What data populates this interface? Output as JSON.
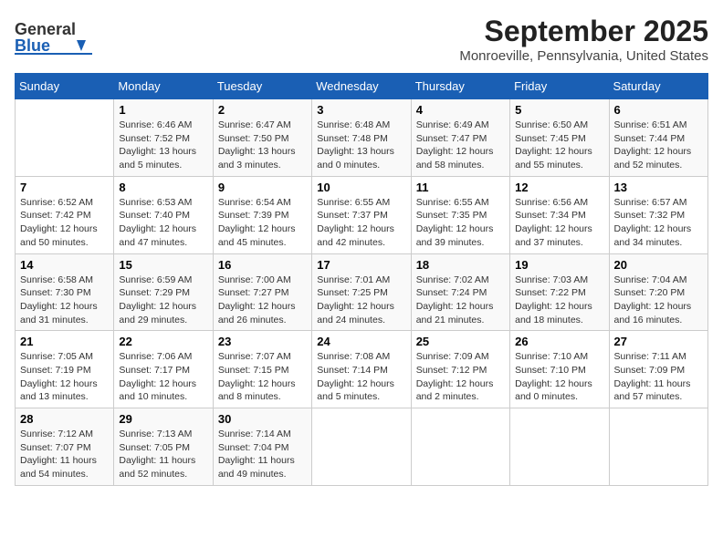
{
  "header": {
    "logo_general": "General",
    "logo_blue": "Blue",
    "title": "September 2025",
    "subtitle": "Monroeville, Pennsylvania, United States"
  },
  "calendar": {
    "days_of_week": [
      "Sunday",
      "Monday",
      "Tuesday",
      "Wednesday",
      "Thursday",
      "Friday",
      "Saturday"
    ],
    "weeks": [
      [
        {
          "date": "",
          "info": ""
        },
        {
          "date": "1",
          "info": "Sunrise: 6:46 AM\nSunset: 7:52 PM\nDaylight: 13 hours\nand 5 minutes."
        },
        {
          "date": "2",
          "info": "Sunrise: 6:47 AM\nSunset: 7:50 PM\nDaylight: 13 hours\nand 3 minutes."
        },
        {
          "date": "3",
          "info": "Sunrise: 6:48 AM\nSunset: 7:48 PM\nDaylight: 13 hours\nand 0 minutes."
        },
        {
          "date": "4",
          "info": "Sunrise: 6:49 AM\nSunset: 7:47 PM\nDaylight: 12 hours\nand 58 minutes."
        },
        {
          "date": "5",
          "info": "Sunrise: 6:50 AM\nSunset: 7:45 PM\nDaylight: 12 hours\nand 55 minutes."
        },
        {
          "date": "6",
          "info": "Sunrise: 6:51 AM\nSunset: 7:44 PM\nDaylight: 12 hours\nand 52 minutes."
        }
      ],
      [
        {
          "date": "7",
          "info": "Sunrise: 6:52 AM\nSunset: 7:42 PM\nDaylight: 12 hours\nand 50 minutes."
        },
        {
          "date": "8",
          "info": "Sunrise: 6:53 AM\nSunset: 7:40 PM\nDaylight: 12 hours\nand 47 minutes."
        },
        {
          "date": "9",
          "info": "Sunrise: 6:54 AM\nSunset: 7:39 PM\nDaylight: 12 hours\nand 45 minutes."
        },
        {
          "date": "10",
          "info": "Sunrise: 6:55 AM\nSunset: 7:37 PM\nDaylight: 12 hours\nand 42 minutes."
        },
        {
          "date": "11",
          "info": "Sunrise: 6:55 AM\nSunset: 7:35 PM\nDaylight: 12 hours\nand 39 minutes."
        },
        {
          "date": "12",
          "info": "Sunrise: 6:56 AM\nSunset: 7:34 PM\nDaylight: 12 hours\nand 37 minutes."
        },
        {
          "date": "13",
          "info": "Sunrise: 6:57 AM\nSunset: 7:32 PM\nDaylight: 12 hours\nand 34 minutes."
        }
      ],
      [
        {
          "date": "14",
          "info": "Sunrise: 6:58 AM\nSunset: 7:30 PM\nDaylight: 12 hours\nand 31 minutes."
        },
        {
          "date": "15",
          "info": "Sunrise: 6:59 AM\nSunset: 7:29 PM\nDaylight: 12 hours\nand 29 minutes."
        },
        {
          "date": "16",
          "info": "Sunrise: 7:00 AM\nSunset: 7:27 PM\nDaylight: 12 hours\nand 26 minutes."
        },
        {
          "date": "17",
          "info": "Sunrise: 7:01 AM\nSunset: 7:25 PM\nDaylight: 12 hours\nand 24 minutes."
        },
        {
          "date": "18",
          "info": "Sunrise: 7:02 AM\nSunset: 7:24 PM\nDaylight: 12 hours\nand 21 minutes."
        },
        {
          "date": "19",
          "info": "Sunrise: 7:03 AM\nSunset: 7:22 PM\nDaylight: 12 hours\nand 18 minutes."
        },
        {
          "date": "20",
          "info": "Sunrise: 7:04 AM\nSunset: 7:20 PM\nDaylight: 12 hours\nand 16 minutes."
        }
      ],
      [
        {
          "date": "21",
          "info": "Sunrise: 7:05 AM\nSunset: 7:19 PM\nDaylight: 12 hours\nand 13 minutes."
        },
        {
          "date": "22",
          "info": "Sunrise: 7:06 AM\nSunset: 7:17 PM\nDaylight: 12 hours\nand 10 minutes."
        },
        {
          "date": "23",
          "info": "Sunrise: 7:07 AM\nSunset: 7:15 PM\nDaylight: 12 hours\nand 8 minutes."
        },
        {
          "date": "24",
          "info": "Sunrise: 7:08 AM\nSunset: 7:14 PM\nDaylight: 12 hours\nand 5 minutes."
        },
        {
          "date": "25",
          "info": "Sunrise: 7:09 AM\nSunset: 7:12 PM\nDaylight: 12 hours\nand 2 minutes."
        },
        {
          "date": "26",
          "info": "Sunrise: 7:10 AM\nSunset: 7:10 PM\nDaylight: 12 hours\nand 0 minutes."
        },
        {
          "date": "27",
          "info": "Sunrise: 7:11 AM\nSunset: 7:09 PM\nDaylight: 11 hours\nand 57 minutes."
        }
      ],
      [
        {
          "date": "28",
          "info": "Sunrise: 7:12 AM\nSunset: 7:07 PM\nDaylight: 11 hours\nand 54 minutes."
        },
        {
          "date": "29",
          "info": "Sunrise: 7:13 AM\nSunset: 7:05 PM\nDaylight: 11 hours\nand 52 minutes."
        },
        {
          "date": "30",
          "info": "Sunrise: 7:14 AM\nSunset: 7:04 PM\nDaylight: 11 hours\nand 49 minutes."
        },
        {
          "date": "",
          "info": ""
        },
        {
          "date": "",
          "info": ""
        },
        {
          "date": "",
          "info": ""
        },
        {
          "date": "",
          "info": ""
        }
      ]
    ]
  }
}
